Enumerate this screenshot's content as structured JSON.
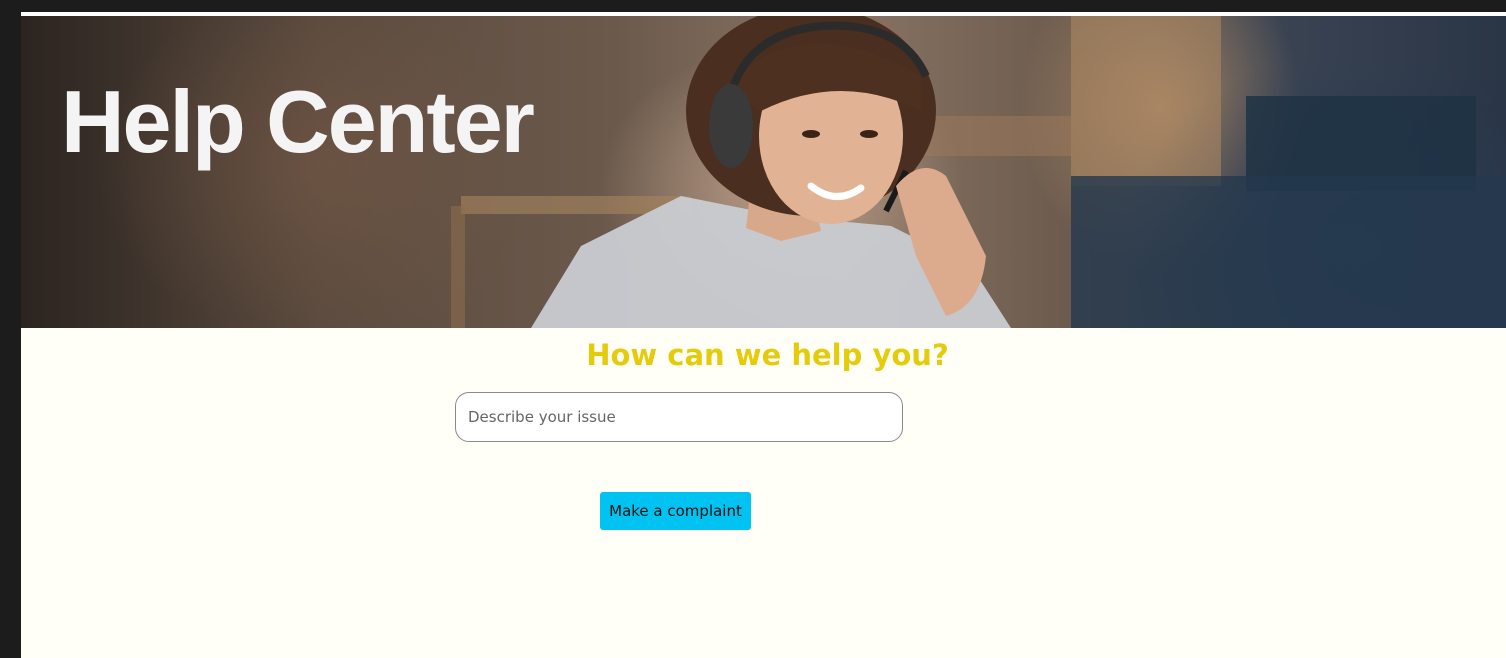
{
  "hero": {
    "title": "Help Center"
  },
  "main": {
    "heading": "How can we help you?",
    "search": {
      "value": "",
      "placeholder": "Describe your issue"
    },
    "complaint_button_label": "Make a complaint"
  },
  "colors": {
    "page_background": "#fffff8",
    "outer_background": "#1c1c1c",
    "heading": "#e4cc0c",
    "button": "#00c3f2",
    "hero_title": "#f4f4f4"
  }
}
